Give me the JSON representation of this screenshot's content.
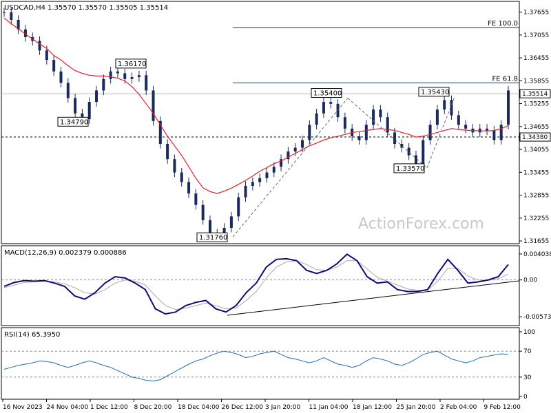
{
  "colors": {
    "candle": "#1a2a5a",
    "ma": "#e0202a",
    "macd": "#0b0b7a",
    "signal": "#a9a9a9",
    "rsi": "#1f6fb0",
    "grid": "#000000",
    "background": "#ffffff"
  },
  "watermark": "ActionForex.com",
  "chart_data": [
    {
      "type": "line",
      "panel": "price",
      "header": "USDCAD,H4  1.35570 1.35570 1.35505 1.35514",
      "y_ticks": [
        "1.37655",
        "1.37055",
        "1.36455",
        "1.35855",
        "1.35255",
        "1.34655",
        "1.34055",
        "1.33455",
        "1.32855",
        "1.32255",
        "1.31655"
      ],
      "ylim": [
        1.3162,
        1.379
      ],
      "x_ticks": [
        "16 Nov 2023",
        "24 Nov 04:00",
        "1 Dec 12:00",
        "8 Dec 20:00",
        "18 Dec 04:00",
        "26 Dec 12:00",
        "3 Jan 20:00",
        "11 Jan 04:00",
        "18 Jan 12:00",
        "25 Jan 20:00",
        "2 Feb 04:00",
        "9 Feb 12:00"
      ],
      "current_price": 1.35514,
      "current_price_label": "1.35514",
      "support_level": 1.3438,
      "support_label": "1.34380",
      "fib_lines": [
        {
          "label": "FE 100.0",
          "value": 1.3725
        },
        {
          "label": "FE 61.8",
          "value": 1.358
        }
      ],
      "annotations": [
        {
          "label": "1.36170",
          "value": 1.3617
        },
        {
          "label": "1.34790",
          "value": 1.3479
        },
        {
          "label": "1.31760",
          "value": 1.3176
        },
        {
          "label": "1.35400",
          "value": 1.354
        },
        {
          "label": "1.33570",
          "value": 1.3357
        },
        {
          "label": "1.35430",
          "value": 1.3543
        }
      ],
      "series": [
        {
          "name": "",
          "kind": "close",
          "values": [
            1.3765,
            1.3745,
            1.372,
            1.37,
            1.369,
            1.3665,
            1.364,
            1.361,
            1.358,
            1.354,
            1.35,
            1.3485,
            1.353,
            1.356,
            1.359,
            1.361,
            1.3605,
            1.359,
            1.3595,
            1.36,
            1.356,
            1.348,
            1.342,
            1.338,
            1.3345,
            1.332,
            1.329,
            1.326,
            1.322,
            1.3185,
            1.318,
            1.32,
            1.323,
            1.328,
            1.331,
            1.332,
            1.333,
            1.3345,
            1.336,
            1.338,
            1.34,
            1.341,
            1.343,
            1.347,
            1.35,
            1.353,
            1.3525,
            1.349,
            1.346,
            1.344,
            1.343,
            1.347,
            1.351,
            1.349,
            1.345,
            1.342,
            1.341,
            1.339,
            1.3365,
            1.343,
            1.347,
            1.351,
            1.3535,
            1.3495,
            1.347,
            1.346,
            1.345,
            1.346,
            1.3455,
            1.343,
            1.347,
            1.356
          ]
        },
        {
          "name": "",
          "kind": "moving_average",
          "values": [
            1.375,
            1.3735,
            1.3722,
            1.3708,
            1.3695,
            1.3682,
            1.367,
            1.3652,
            1.364,
            1.3625,
            1.3612,
            1.3605,
            1.36,
            1.3598,
            1.3598,
            1.3596,
            1.3592,
            1.3585,
            1.357,
            1.355,
            1.3525,
            1.35,
            1.347,
            1.344,
            1.3415,
            1.339,
            1.336,
            1.333,
            1.3305,
            1.3295,
            1.329,
            1.3296,
            1.3304,
            1.3314,
            1.3324,
            1.3336,
            1.3348,
            1.3358,
            1.3368,
            1.3375,
            1.3385,
            1.3395,
            1.3405,
            1.3415,
            1.3422,
            1.343,
            1.3436,
            1.344,
            1.3445,
            1.345,
            1.3452,
            1.3455,
            1.3458,
            1.346,
            1.3458,
            1.3455,
            1.345,
            1.3445,
            1.3438,
            1.344,
            1.3445,
            1.345,
            1.3455,
            1.346,
            1.3458,
            1.3456,
            1.3455,
            1.3454,
            1.3454,
            1.3455,
            1.346,
            1.3468
          ]
        }
      ]
    },
    {
      "type": "line",
      "panel": "macd",
      "header": "MACD(12,26,9) 0.002379 0.000886",
      "y_ticks": [
        "0.004038",
        "0.00",
        "-0.005737"
      ],
      "ylim": [
        -0.007,
        0.005
      ],
      "series": [
        {
          "name": "",
          "kind": "macd",
          "values": [
            -0.001,
            -0.0004,
            -0.0001,
            -0.0002,
            -0.0001,
            -0.0005,
            -0.001,
            -0.0025,
            -0.003,
            -0.002,
            -0.0005,
            0.0005,
            0.0003,
            -0.0005,
            -0.0015,
            -0.0045,
            -0.0053,
            -0.005,
            -0.004,
            -0.0035,
            -0.0032,
            -0.0045,
            -0.005,
            -0.004,
            -0.002,
            -0.0005,
            0.002,
            0.0032,
            0.0033,
            0.003,
            0.0015,
            0.001,
            0.0015,
            0.0025,
            0.004,
            0.003,
            0.0005,
            -0.0005,
            -0.0003,
            -0.0015,
            -0.0018,
            -0.0018,
            -0.0015,
            0.001,
            0.0032,
            0.0015,
            -0.0005,
            -0.0003,
            0.0,
            0.0005,
            0.0024
          ]
        },
        {
          "name": "",
          "kind": "signal",
          "values": [
            -0.0012,
            -0.0008,
            -0.0004,
            -0.0003,
            -0.0002,
            -0.0003,
            -0.0006,
            -0.0012,
            -0.002,
            -0.0022,
            -0.0015,
            -0.0005,
            0.0,
            -0.0002,
            -0.0008,
            -0.0025,
            -0.004,
            -0.0046,
            -0.0044,
            -0.004,
            -0.0036,
            -0.004,
            -0.0045,
            -0.0044,
            -0.0032,
            -0.0018,
            0.0003,
            0.002,
            0.0028,
            0.003,
            0.0024,
            0.0016,
            0.0015,
            0.002,
            0.003,
            0.003,
            0.0017,
            0.0004,
            -0.0002,
            -0.0008,
            -0.0014,
            -0.0016,
            -0.0016,
            -0.0002,
            0.0018,
            0.0018,
            0.0006,
            0.0,
            -0.0001,
            0.0002,
            0.0009
          ]
        }
      ]
    },
    {
      "type": "line",
      "panel": "rsi",
      "header": "RSI(14) 65.3950",
      "y_ticks": [
        "100",
        "70",
        "30",
        "0"
      ],
      "ylim": [
        0,
        100
      ],
      "levels": [
        70,
        30
      ],
      "series": [
        {
          "name": "",
          "kind": "rsi",
          "values": [
            42,
            45,
            48,
            50,
            52,
            55,
            54,
            52,
            48,
            45,
            48,
            52,
            55,
            52,
            48,
            45,
            40,
            35,
            30,
            28,
            25,
            24,
            26,
            32,
            38,
            44,
            50,
            55,
            58,
            63,
            67,
            70,
            68,
            65,
            60,
            62,
            66,
            68,
            70,
            65,
            60,
            58,
            55,
            52,
            55,
            60,
            55,
            50,
            48,
            45,
            48,
            55,
            60,
            58,
            55,
            50,
            48,
            52,
            58,
            65,
            68,
            70,
            64,
            58,
            55,
            52,
            55,
            60,
            62,
            64,
            66,
            65
          ]
        }
      ]
    }
  ]
}
